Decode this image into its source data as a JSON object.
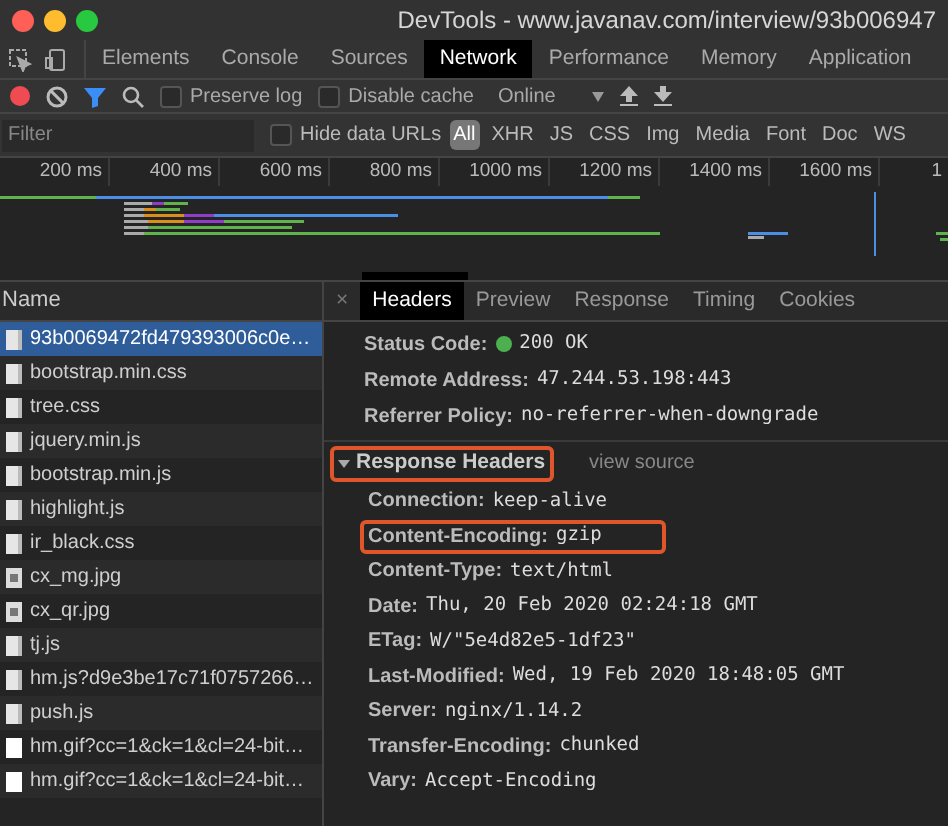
{
  "window": {
    "title": "DevTools - www.javanav.com/interview/93b006947"
  },
  "panel_tabs": [
    {
      "label": "Elements",
      "selected": false
    },
    {
      "label": "Console",
      "selected": false
    },
    {
      "label": "Sources",
      "selected": false
    },
    {
      "label": "Network",
      "selected": true
    },
    {
      "label": "Performance",
      "selected": false
    },
    {
      "label": "Memory",
      "selected": false
    },
    {
      "label": "Application",
      "selected": false
    }
  ],
  "toolbar": {
    "recording": true,
    "preserve_log": {
      "label": "Preserve log",
      "checked": false
    },
    "disable_cache": {
      "label": "Disable cache",
      "checked": false
    },
    "throttling": "Online"
  },
  "filter": {
    "placeholder": "Filter",
    "hide_data_urls": {
      "label": "Hide data URLs",
      "checked": false
    },
    "types": [
      {
        "label": "All",
        "selected": true
      },
      {
        "label": "XHR",
        "selected": false
      },
      {
        "label": "JS",
        "selected": false
      },
      {
        "label": "CSS",
        "selected": false
      },
      {
        "label": "Img",
        "selected": false
      },
      {
        "label": "Media",
        "selected": false
      },
      {
        "label": "Font",
        "selected": false
      },
      {
        "label": "Doc",
        "selected": false
      },
      {
        "label": "WS",
        "selected": false
      }
    ]
  },
  "timeline": {
    "ticks": [
      "200 ms",
      "400 ms",
      "600 ms",
      "800 ms",
      "1000 ms",
      "1200 ms",
      "1400 ms",
      "1600 ms",
      "1"
    ]
  },
  "requests": {
    "column": "Name",
    "rows": [
      {
        "name": "93b0069472fd479393006c0e…",
        "kind": "doc",
        "selected": true
      },
      {
        "name": "bootstrap.min.css",
        "kind": "doc",
        "selected": false
      },
      {
        "name": "tree.css",
        "kind": "doc",
        "selected": false
      },
      {
        "name": "jquery.min.js",
        "kind": "doc",
        "selected": false
      },
      {
        "name": "bootstrap.min.js",
        "kind": "doc",
        "selected": false
      },
      {
        "name": "highlight.js",
        "kind": "doc",
        "selected": false
      },
      {
        "name": "ir_black.css",
        "kind": "doc",
        "selected": false
      },
      {
        "name": "cx_mg.jpg",
        "kind": "image",
        "selected": false
      },
      {
        "name": "cx_qr.jpg",
        "kind": "image",
        "selected": false
      },
      {
        "name": "tj.js",
        "kind": "doc",
        "selected": false
      },
      {
        "name": "hm.js?d9e3be17c71f0757266…",
        "kind": "doc",
        "selected": false
      },
      {
        "name": "push.js",
        "kind": "doc",
        "selected": false
      },
      {
        "name": "hm.gif?cc=1&ck=1&cl=24-bit…",
        "kind": "blank",
        "selected": false
      },
      {
        "name": "hm.gif?cc=1&ck=1&cl=24-bit…",
        "kind": "blank",
        "selected": false
      }
    ]
  },
  "detail": {
    "close": "×",
    "tabs": [
      {
        "label": "Headers",
        "selected": true
      },
      {
        "label": "Preview",
        "selected": false
      },
      {
        "label": "Response",
        "selected": false
      },
      {
        "label": "Timing",
        "selected": false
      },
      {
        "label": "Cookies",
        "selected": false
      }
    ],
    "general": [
      {
        "name": "Status Code:",
        "value": "200 OK",
        "status_ok": true
      },
      {
        "name": "Remote Address:",
        "value": "47.244.53.198:443"
      },
      {
        "name": "Referrer Policy:",
        "value": "no-referrer-when-downgrade"
      }
    ],
    "response_headers": {
      "title": "Response Headers",
      "expanded": true,
      "highlighted": true,
      "view_source": "view source",
      "items": [
        {
          "name": "Connection:",
          "value": "keep-alive",
          "highlighted": false
        },
        {
          "name": "Content-Encoding:",
          "value": "gzip",
          "highlighted": true
        },
        {
          "name": "Content-Type:",
          "value": "text/html",
          "highlighted": false
        },
        {
          "name": "Date:",
          "value": "Thu, 20 Feb 2020 02:24:18 GMT",
          "highlighted": false
        },
        {
          "name": "ETag:",
          "value": "W/\"5e4d82e5-1df23\"",
          "highlighted": false
        },
        {
          "name": "Last-Modified:",
          "value": "Wed, 19 Feb 2020 18:48:05 GMT",
          "highlighted": false
        },
        {
          "name": "Server:",
          "value": "nginx/1.14.2",
          "highlighted": false
        },
        {
          "name": "Transfer-Encoding:",
          "value": "chunked",
          "highlighted": false
        },
        {
          "name": "Vary:",
          "value": "Accept-Encoding",
          "highlighted": false
        }
      ]
    }
  }
}
